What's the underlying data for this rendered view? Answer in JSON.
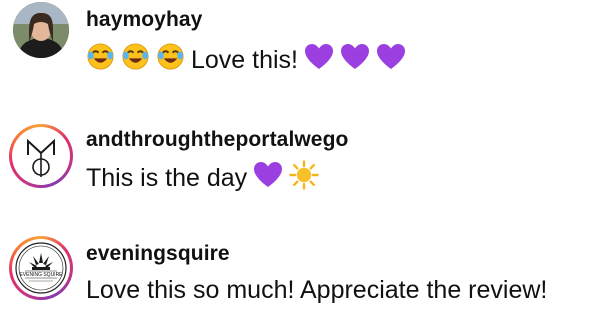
{
  "comments": [
    {
      "username": "haymoyhay",
      "text": "Love this!",
      "leading_emoji": [
        "face-with-tears-of-joy",
        "face-with-tears-of-joy",
        "face-with-tears-of-joy"
      ],
      "trailing_emoji": [
        "purple-heart",
        "purple-heart",
        "purple-heart"
      ]
    },
    {
      "username": "andthroughtheportalwego",
      "text": "This is the day",
      "trailing_emoji": [
        "purple-heart",
        "sun"
      ]
    },
    {
      "username": "eveningsquire",
      "text": "Love this so much! Appreciate the review!",
      "avatar_logo_text": "EVENING SQUIRE"
    }
  ],
  "colors": {
    "purple_heart": "#9b3fe0",
    "sun": "#f5b51c",
    "story_ring_start": "#f9a23a",
    "story_ring_end": "#c13584"
  }
}
